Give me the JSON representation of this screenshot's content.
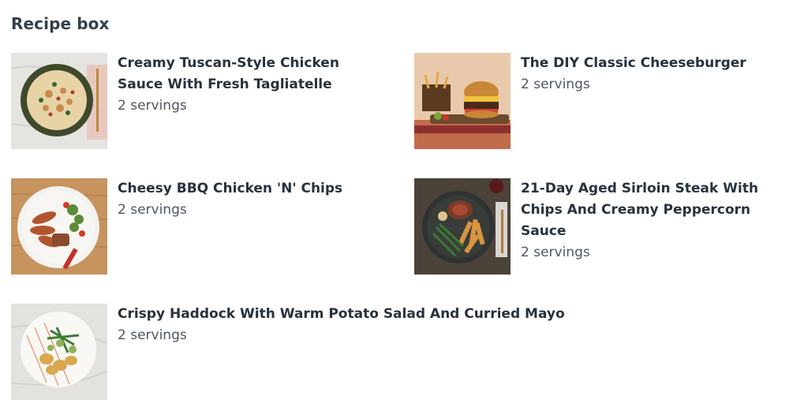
{
  "header": {
    "title": "Recipe box"
  },
  "recipes": [
    {
      "name": "Creamy Tuscan-Style Chicken Sauce With Fresh Tagliatelle",
      "servings": "2 servings"
    },
    {
      "name": "The DIY Classic Cheeseburger",
      "servings": "2 servings"
    },
    {
      "name": "Cheesy BBQ Chicken 'N' Chips",
      "servings": "2 servings"
    },
    {
      "name": "21-Day Aged Sirloin Steak With Chips And Creamy Peppercorn Sauce",
      "servings": "2 servings"
    },
    {
      "name": "Crispy Haddock With Warm Potato Salad And Curried Mayo",
      "servings": "2 servings"
    }
  ]
}
